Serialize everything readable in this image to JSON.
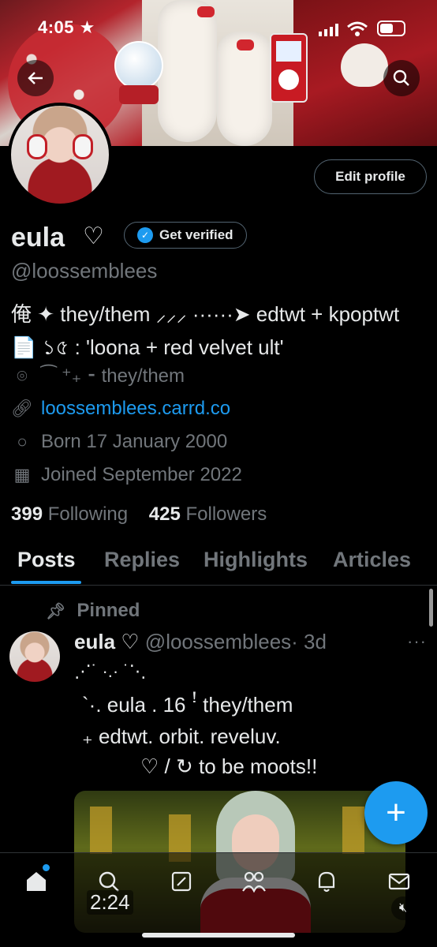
{
  "status": {
    "time": "4:05 ★"
  },
  "profile": {
    "display_name": "eula",
    "name_suffix": "♡",
    "get_verified_label": "Get verified",
    "handle": "@loossemblees",
    "edit_profile_label": "Edit profile",
    "bio_lines": [
      "俺 ✦ they/them ⸝⸝⸝ ······➤ edtwt + kpoptwt",
      "📄 ১৫ : 'loona + red velvet ult'"
    ],
    "location": "⁀ ⁺₊ ⁃ they/them",
    "website": "loossemblees.carrd.co",
    "birthday": "Born 17 January 2000",
    "joined": "Joined September 2022",
    "following_count": "399",
    "following_label": "Following",
    "followers_count": "425",
    "followers_label": "Followers"
  },
  "tabs": [
    "Posts",
    "Replies",
    "Highlights",
    "Articles"
  ],
  "pinned_post": {
    "pinned_label": "Pinned",
    "author_name": "eula ♡",
    "author_handle": "@loossemblees",
    "time": "· 3d",
    "lines": [
      "⋰˙ ·.· ˙⋱",
      "`·.  eula  .  16 ꜝ   they/them",
      "₊ edtwt. orbit. reveluv.",
      "♡ / ↻ to be moots!!"
    ],
    "video_duration": "2:24"
  },
  "icons": {
    "back": "back-arrow-icon",
    "search": "search-icon",
    "verified": "verified-badge-icon",
    "location": "location-icon",
    "link": "link-icon",
    "birthday": "balloon-icon",
    "calendar": "calendar-icon",
    "pin": "pin-icon",
    "more": "more-icon",
    "compose": "plus-icon",
    "home": "home-icon",
    "explore": "search-icon",
    "grok": "grok-icon",
    "communities": "communities-icon",
    "notifications": "bell-icon",
    "messages": "mail-icon",
    "mute": "mute-icon"
  },
  "colors": {
    "accent": "#1d9bf0",
    "background": "#000000",
    "text": "#e7e9ea",
    "muted": "#71767b"
  }
}
